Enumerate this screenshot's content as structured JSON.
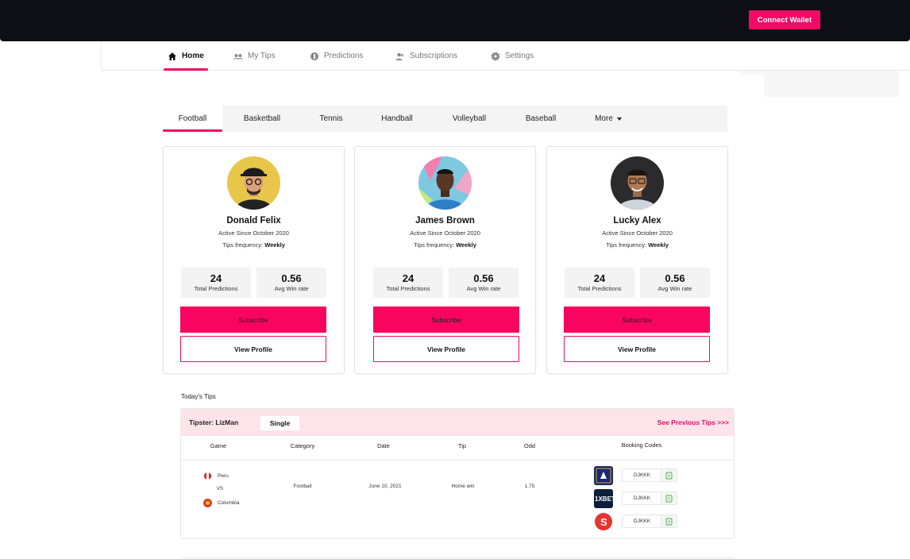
{
  "header": {
    "connect_wallet": "Connect Wallet"
  },
  "nav": {
    "items": [
      {
        "label": "Home",
        "icon": "home-icon",
        "active": true
      },
      {
        "label": "My Tips",
        "icon": "tips-icon",
        "active": false
      },
      {
        "label": "Predictions",
        "icon": "predictions-icon",
        "active": false
      },
      {
        "label": "Subscriptions",
        "icon": "users-icon",
        "active": false
      },
      {
        "label": "Settings",
        "icon": "gear-icon",
        "active": false
      }
    ]
  },
  "sports": {
    "tabs": [
      "Football",
      "Basketball",
      "Tennis",
      "Handball",
      "Volleyball",
      "Baseball",
      "More"
    ],
    "active": "Football"
  },
  "tipsters": [
    {
      "name": "Donald Felix",
      "since": "Active Since October 2020",
      "freq_label": "Tips frequency:",
      "freq": "Weekly",
      "total": "24",
      "total_label": "Total Predictions",
      "winrate": "0.56",
      "winrate_label": "Avg Win rate",
      "subscribe": "Subscribe",
      "view": "View Profile"
    },
    {
      "name": "James Brown",
      "since": "Active Since October 2020",
      "freq_label": "Tips frequency:",
      "freq": "Weekly",
      "total": "24",
      "total_label": "Total Predictions",
      "winrate": "0.56",
      "winrate_label": "Avg Win rate",
      "subscribe": "Subscribe",
      "view": "View Profile"
    },
    {
      "name": "Lucky Alex",
      "since": "Active Since October 2020",
      "freq_label": "Tips frequency:",
      "freq": "Weekly",
      "total": "24",
      "total_label": "Total Predictions",
      "winrate": "0.56",
      "winrate_label": "Avg Win rate",
      "subscribe": "Subscribe",
      "view": "View Profile"
    }
  ],
  "today": {
    "title": "Today's Tips",
    "tipster": "Tipster: LizMan",
    "type": "Single",
    "see_previous": "See Previous Tips >>>",
    "columns": [
      "Game",
      "Category",
      "Date",
      "Tip",
      "Odd",
      "Booking Codes"
    ],
    "row": {
      "home": "Peru",
      "vs": "VS",
      "away": "Columbia",
      "category": "Football",
      "date": "June 10, 2021",
      "tip": "Home win",
      "odd": "1.75",
      "codes": [
        {
          "book": "bookmaker-1-logo",
          "code": "DJKKK"
        },
        {
          "book": "1xbet-logo",
          "code": "DJKKK"
        },
        {
          "book": "bookmaker-3-logo",
          "code": "DJKKK"
        }
      ]
    }
  },
  "colors": {
    "accent": "#f20a66",
    "topbar": "#0e0f14"
  }
}
